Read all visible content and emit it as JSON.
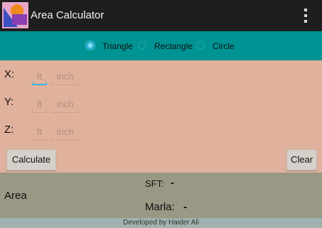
{
  "app": {
    "title": "Area Calculator",
    "icon": "app-logo-icon",
    "menu_icon": "overflow-menu-icon"
  },
  "shape_selector": {
    "options": [
      {
        "label": "Triangle",
        "checked": true
      },
      {
        "label": "Rectangle",
        "checked": false
      },
      {
        "label": "Circle",
        "checked": false
      }
    ]
  },
  "inputs": {
    "rows": [
      {
        "label": "X:",
        "ft_placeholder": "ft",
        "inch_placeholder": "inch"
      },
      {
        "label": "Y:",
        "ft_placeholder": "ft",
        "inch_placeholder": "inch"
      },
      {
        "label": "Z:",
        "ft_placeholder": "ft",
        "inch_placeholder": "inch"
      }
    ]
  },
  "buttons": {
    "calculate": "Calculate",
    "clear": "Clear"
  },
  "results": {
    "area_label": "Area",
    "sft_label": "SFT:",
    "sft_value": "-",
    "marla_label": "Marla:",
    "marla_value": "-"
  },
  "footer": {
    "text": "Developed by Haider Ali"
  },
  "colors": {
    "action_bar": "#1e1e1e",
    "shape_bar": "#009393",
    "input_panel": "#e0b19c",
    "result_panel": "#999884",
    "footer": "#9fb2b0",
    "accent": "#33b5e5"
  }
}
